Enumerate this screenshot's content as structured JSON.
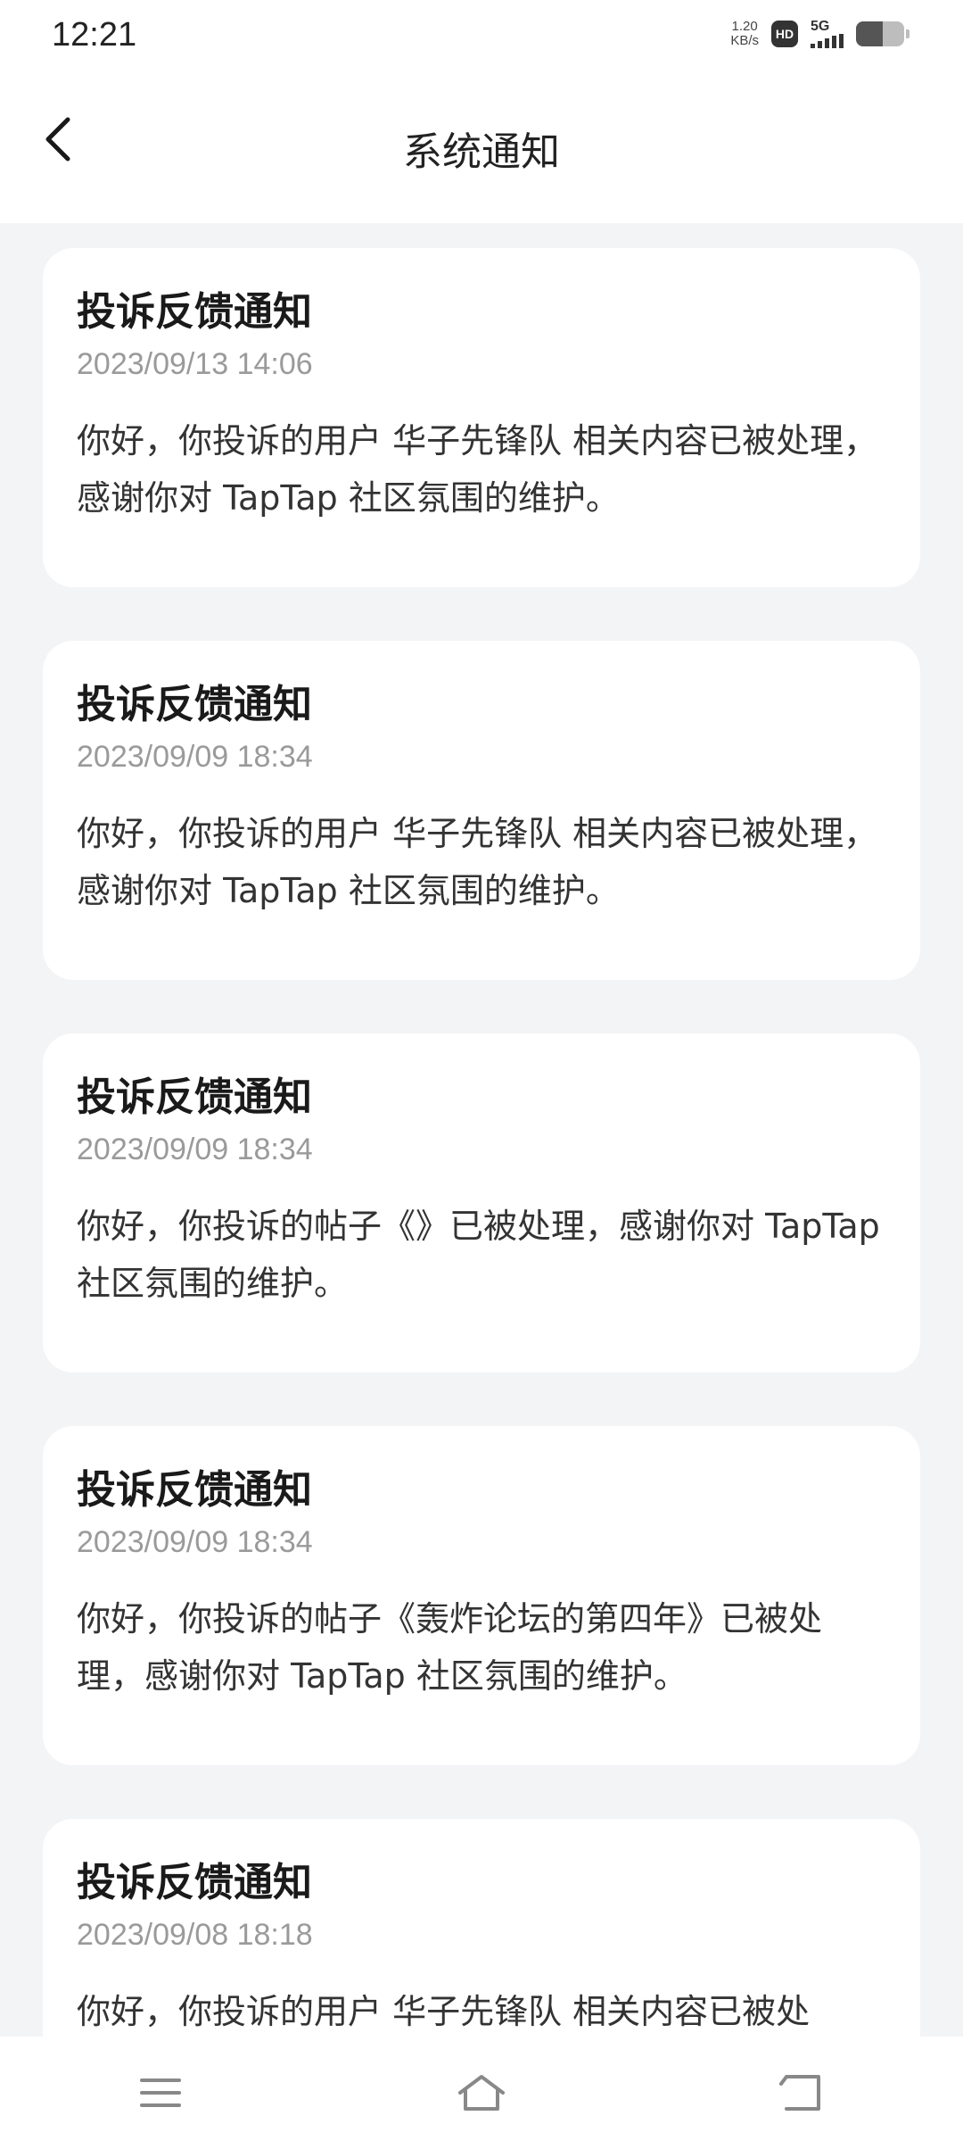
{
  "status_bar": {
    "time": "12:21",
    "net_speed_value": "1.20",
    "net_speed_unit": "KB/s",
    "hd_label": "HD",
    "network_label": "5G",
    "battery_level": 0.55
  },
  "header": {
    "title": "系统通知"
  },
  "notifications": [
    {
      "title": "投诉反馈通知",
      "time": "2023/09/13 14:06",
      "body": "你好，你投诉的用户 华子先锋队 相关内容已被处理，感谢你对 TapTap 社区氛围的维护。"
    },
    {
      "title": "投诉反馈通知",
      "time": "2023/09/09 18:34",
      "body": "你好，你投诉的用户 华子先锋队 相关内容已被处理，感谢你对 TapTap 社区氛围的维护。"
    },
    {
      "title": "投诉反馈通知",
      "time": "2023/09/09 18:34",
      "body": "你好，你投诉的帖子《》已被处理，感谢你对 TapTap 社区氛围的维护。"
    },
    {
      "title": "投诉反馈通知",
      "time": "2023/09/09 18:34",
      "body": "你好，你投诉的帖子《轰炸论坛的第四年》已被处理，感谢你对 TapTap 社区氛围的维护。"
    },
    {
      "title": "投诉反馈通知",
      "time": "2023/09/08 18:18",
      "body": "你好，你投诉的用户 华子先锋队 相关内容已被处"
    }
  ],
  "icons": {
    "back": "chevron-left-icon",
    "menu": "menu-icon",
    "home": "home-icon",
    "return": "return-icon"
  }
}
